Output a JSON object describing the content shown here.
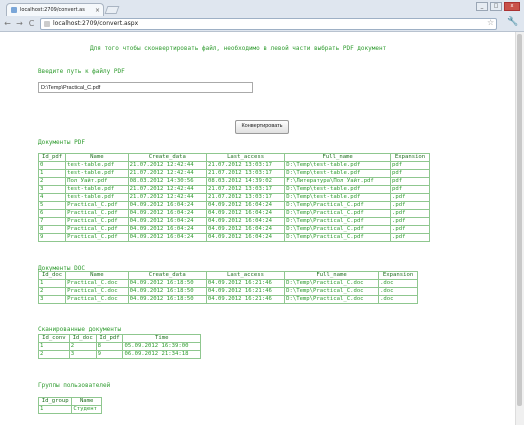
{
  "browser": {
    "tab_title": "localhost:2709/convert.as",
    "tab_close": "×",
    "url": "localhost:2709/convert.aspx",
    "back": "←",
    "forward": "→",
    "reload": "C"
  },
  "page": {
    "intro": "Для того чтобы сконвертировать файл, необходимо в левой части выбрать PDF документ",
    "path_label": "Введите путь к файлу PDF",
    "path_value": "D:\\Temp\\Practical_C.pdf",
    "convert_label": "Конвертировать"
  },
  "pdf_docs": {
    "title": "Документы PDF",
    "columns": [
      "Id_pdf",
      "Name",
      "Create_data",
      "Last_access",
      "Full_name",
      "Expansion"
    ],
    "rows": [
      [
        "0",
        "test-table.pdf",
        "21.07.2012 12:42:44",
        "21.07.2012 13:03:17",
        "D:\\Temp\\test-table.pdf",
        "pdf"
      ],
      [
        "1",
        "test-table.pdf",
        "21.07.2012 12:42:44",
        "21.07.2012 13:03:17",
        "D:\\Temp\\test-table.pdf",
        "pdf"
      ],
      [
        "2",
        "Пол Уайт.pdf",
        "08.03.2012 14:30:56",
        "08.03.2012 14:39:02",
        "F:\\Литература\\Пол Уайт.pdf",
        "pdf"
      ],
      [
        "3",
        "test-table.pdf",
        "21.07.2012 12:42:44",
        "21.07.2012 13:03:17",
        "D:\\Temp\\test-table.pdf",
        "pdf"
      ],
      [
        "4",
        "test-table.pdf",
        "21.07.2012 12:42:44",
        "21.07.2012 13:03:17",
        "D:\\Temp\\test-table.pdf",
        ".pdf"
      ],
      [
        "5",
        "Practical_C.pdf",
        "04.09.2012 16:04:24",
        "04.09.2012 16:04:24",
        "D:\\Temp\\Practical_C.pdf",
        ".pdf"
      ],
      [
        "6",
        "Practical_C.pdf",
        "04.09.2012 16:04:24",
        "04.09.2012 16:04:24",
        "D:\\Temp\\Practical_C.pdf",
        ".pdf"
      ],
      [
        "7",
        "Practical_C.pdf",
        "04.09.2012 16:04:24",
        "04.09.2012 16:04:24",
        "D:\\Temp\\Practical_C.pdf",
        ".pdf"
      ],
      [
        "8",
        "Practical_C.pdf",
        "04.09.2012 16:04:24",
        "04.09.2012 16:04:24",
        "D:\\Temp\\Practical_C.pdf",
        ".pdf"
      ],
      [
        "9",
        "Practical_C.pdf",
        "04.09.2012 16:04:24",
        "04.09.2012 16:04:24",
        "D:\\Temp\\Practical_C.pdf",
        ".pdf"
      ]
    ]
  },
  "doc_docs": {
    "title": "Документы DOC",
    "columns": [
      "Id_doc",
      "Name",
      "Create_data",
      "Last_access",
      "Full_name",
      "Expansion"
    ],
    "rows": [
      [
        "1",
        "Practical_C.doc",
        "04.09.2012 16:18:50",
        "04.09.2012 16:21:46",
        "D:\\Temp\\Practical_C.doc",
        ".doc"
      ],
      [
        "2",
        "Practical_C.doc",
        "04.09.2012 16:18:50",
        "04.09.2012 16:21:46",
        "D:\\Temp\\Practical_C.doc",
        ".doc"
      ],
      [
        "3",
        "Practical_C.doc",
        "04.09.2012 16:18:50",
        "04.09.2012 16:21:46",
        "D:\\Temp\\Practical_C.doc",
        ".doc"
      ]
    ]
  },
  "converted_docs": {
    "title": "Сканированные документы",
    "columns": [
      "Id_conv",
      "Id_doc",
      "Id_pdf",
      "Time"
    ],
    "rows": [
      [
        "1",
        "2",
        "8",
        "05.09.2012 16:39:00"
      ],
      [
        "2",
        "3",
        "9",
        "06.09.2012 21:34:18"
      ]
    ]
  },
  "user_groups": {
    "title": "Группы пользователей",
    "columns": [
      "Id_group",
      "Name"
    ],
    "rows": [
      [
        "1",
        "Студент"
      ]
    ]
  },
  "colors": {
    "text_green": "#2e9b2e",
    "grid_border": "#8fc78f"
  }
}
